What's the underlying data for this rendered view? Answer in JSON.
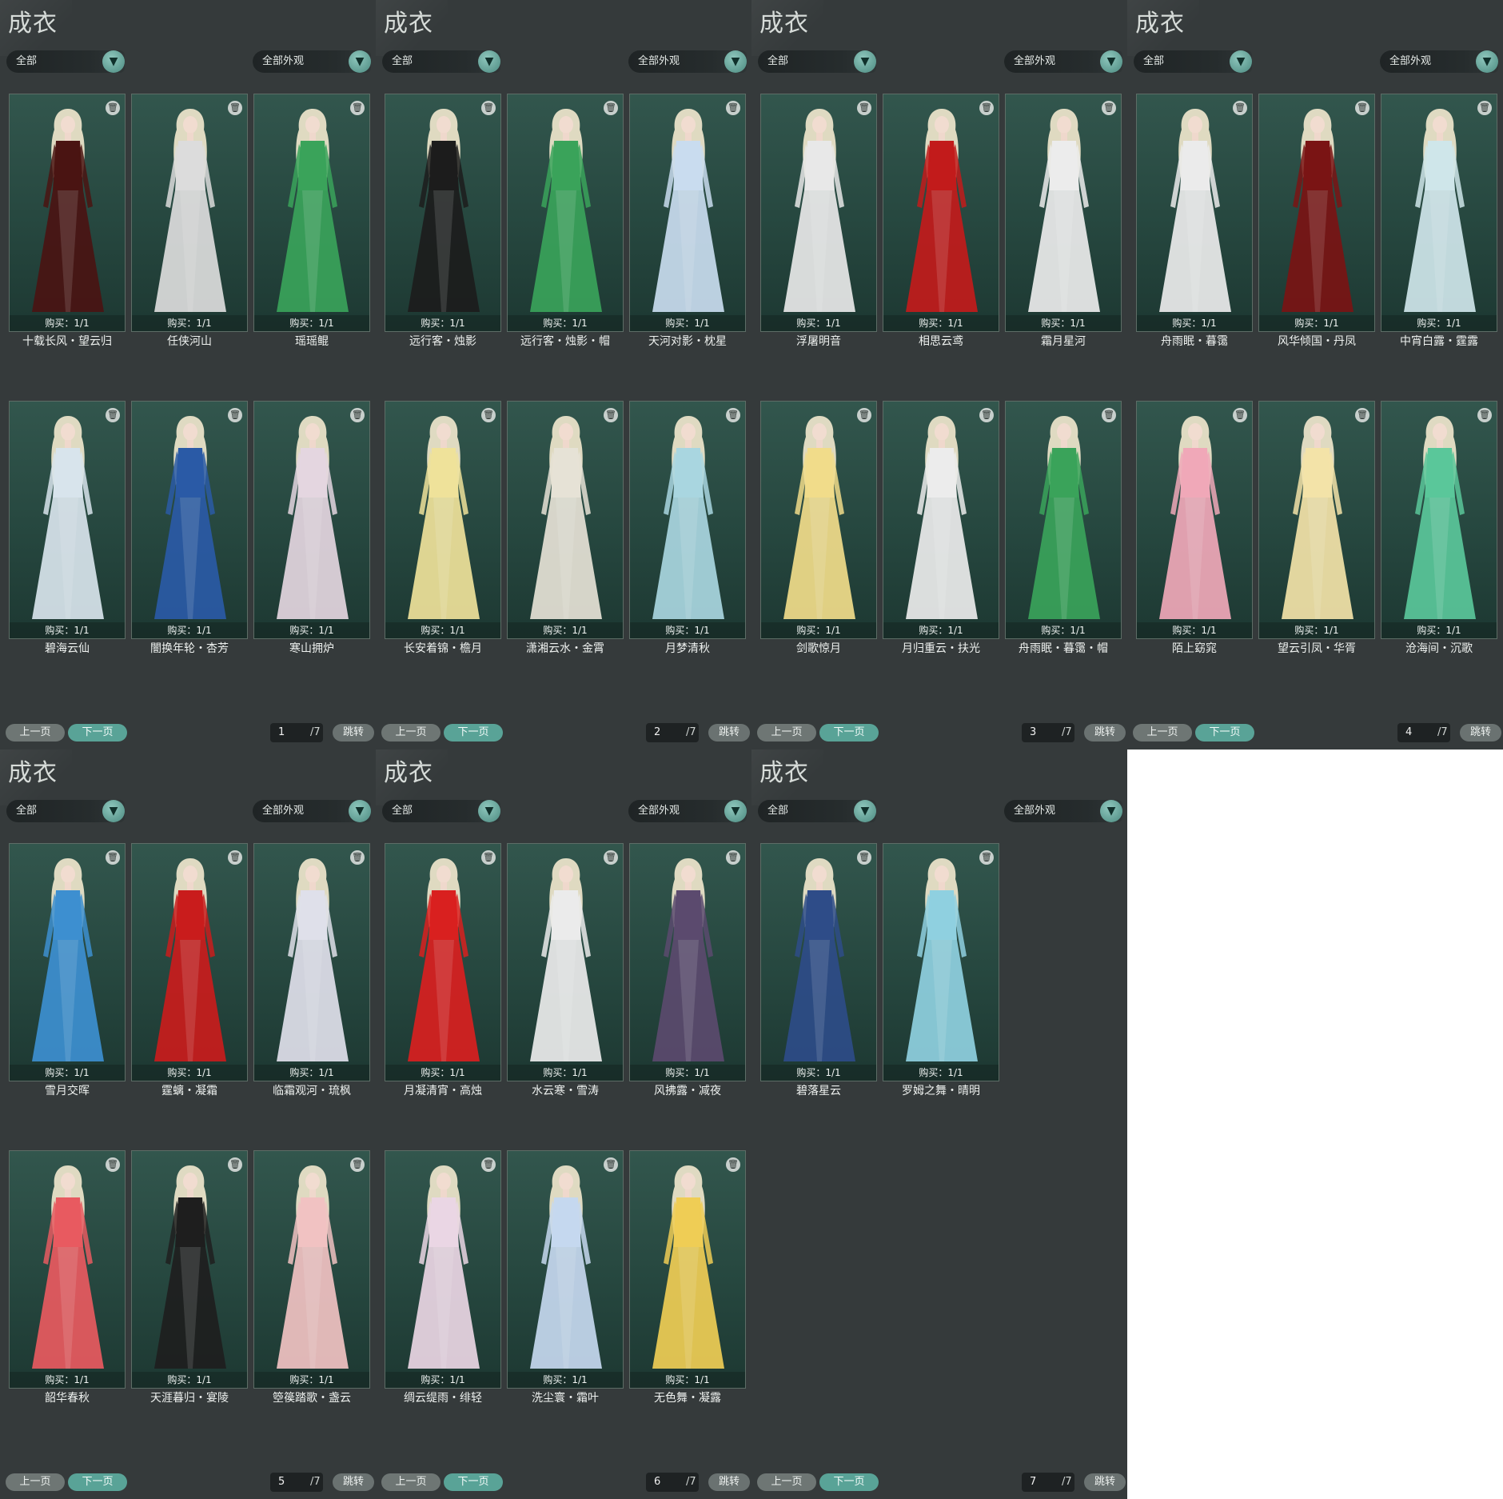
{
  "colors": {
    "panel_bg": "#353a3b",
    "card_bg": "#2a4b43",
    "accent": "#59a397",
    "page_bg": "#ffffff"
  },
  "panels": [
    {
      "title": "成衣",
      "filter_left": "全部",
      "filter_right": "全部外观",
      "prev_label": "上一页",
      "next_label": "下一页",
      "page": "1",
      "total": "/7",
      "jump_label": "跳转",
      "items": [
        {
          "name": "十载长风・望云归",
          "buy": "购买：1/1",
          "color": "#4a1412"
        },
        {
          "name": "任侠河山",
          "buy": "购买：1/1",
          "color": "#dcdcdc"
        },
        {
          "name": "瑶瑶鲲",
          "buy": "购买：1/1",
          "color": "#3aa35a"
        },
        {
          "name": "碧海云仙",
          "buy": "购买：1/1",
          "color": "#d8e4ec"
        },
        {
          "name": "闇换年轮・杏芳",
          "buy": "购买：1/1",
          "color": "#2a5aa6"
        },
        {
          "name": "寒山拥炉",
          "buy": "购买：1/1",
          "color": "#e4d6e0"
        }
      ]
    },
    {
      "title": "成衣",
      "filter_left": "全部",
      "filter_right": "全部外观",
      "prev_label": "上一页",
      "next_label": "下一页",
      "page": "2",
      "total": "/7",
      "jump_label": "跳转",
      "items": [
        {
          "name": "远行客・烛影",
          "buy": "购买：1/1",
          "color": "#1c1c1c"
        },
        {
          "name": "远行客・烛影・帽",
          "buy": "购买：1/1",
          "color": "#3aa35a"
        },
        {
          "name": "天河对影・枕星",
          "buy": "购买：1/1",
          "color": "#c9dcef"
        },
        {
          "name": "长安着锦・檐月",
          "buy": "购买：1/1",
          "color": "#efe29a"
        },
        {
          "name": "潇湘云水・金霄",
          "buy": "购买：1/1",
          "color": "#e6e2d6"
        },
        {
          "name": "月梦清秋",
          "buy": "购买：1/1",
          "color": "#a9d6e0"
        }
      ]
    },
    {
      "title": "成衣",
      "filter_left": "全部",
      "filter_right": "全部外观",
      "prev_label": "上一页",
      "next_label": "下一页",
      "page": "3",
      "total": "/7",
      "jump_label": "跳转",
      "items": [
        {
          "name": "浮屠明音",
          "buy": "购买：1/1",
          "color": "#e8e8e8"
        },
        {
          "name": "相思云鸢",
          "buy": "购买：1/1",
          "color": "#c21b1b"
        },
        {
          "name": "霜月星河",
          "buy": "购买：1/1",
          "color": "#ececec"
        },
        {
          "name": "剑歌惊月",
          "buy": "购买：1/1",
          "color": "#f1dc8a"
        },
        {
          "name": "月归重云・扶光",
          "buy": "购买：1/1",
          "color": "#ececec"
        },
        {
          "name": "舟雨眠・暮霭・帽",
          "buy": "购买：1/1",
          "color": "#3aa35a"
        }
      ]
    },
    {
      "title": "成衣",
      "filter_left": "全部",
      "filter_right": "全部外观",
      "prev_label": "上一页",
      "next_label": "下一页",
      "page": "4",
      "total": "/7",
      "jump_label": "跳转",
      "items": [
        {
          "name": "舟雨眠・暮霭",
          "buy": "购买：1/1",
          "color": "#ebebeb"
        },
        {
          "name": "风华倾国・丹凤",
          "buy": "购买：1/1",
          "color": "#7a1414"
        },
        {
          "name": "中宵白露・霆露",
          "buy": "购买：1/1",
          "color": "#cfe6ea"
        },
        {
          "name": "陌上窈窕",
          "buy": "购买：1/1",
          "color": "#f0a8b8"
        },
        {
          "name": "望云引凤・华胥",
          "buy": "购买：1/1",
          "color": "#f3e3a8"
        },
        {
          "name": "沧海间・沉歌",
          "buy": "购买：1/1",
          "color": "#5ac79a"
        }
      ]
    },
    {
      "title": "成衣",
      "filter_left": "全部",
      "filter_right": "全部外观",
      "prev_label": "上一页",
      "next_label": "下一页",
      "page": "5",
      "total": "/7",
      "jump_label": "跳转",
      "items": [
        {
          "name": "雪月交晖",
          "buy": "购买：1/1",
          "color": "#3d8fd0"
        },
        {
          "name": "霆螭・凝霜",
          "buy": "购买：1/1",
          "color": "#c91c1c"
        },
        {
          "name": "临霜观河・琉枫",
          "buy": "购买：1/1",
          "color": "#dfe0ea"
        },
        {
          "name": "韶华春秋",
          "buy": "购买：1/1",
          "color": "#e85a60"
        },
        {
          "name": "天涯暮归・宴陵",
          "buy": "购买：1/1",
          "color": "#1e1e1e"
        },
        {
          "name": "箜篌踏歌・盏云",
          "buy": "购买：1/1",
          "color": "#f1c2c2"
        }
      ]
    },
    {
      "title": "成衣",
      "filter_left": "全部",
      "filter_right": "全部外观",
      "prev_label": "上一页",
      "next_label": "下一页",
      "page": "6",
      "total": "/7",
      "jump_label": "跳转",
      "items": [
        {
          "name": "月凝清宵・高烛",
          "buy": "购买：1/1",
          "color": "#d9201f"
        },
        {
          "name": "水云寒・雪涛",
          "buy": "购买：1/1",
          "color": "#ebebeb"
        },
        {
          "name": "风拂露・减夜",
          "buy": "购买：1/1",
          "color": "#5b4a6e"
        },
        {
          "name": "绸云缇雨・绯轻",
          "buy": "购买：1/1",
          "color": "#ead6e4"
        },
        {
          "name": "洗尘寰・霜叶",
          "buy": "购买：1/1",
          "color": "#c5d8ef"
        },
        {
          "name": "无色舞・凝露",
          "buy": "购买：1/1",
          "color": "#efcd55"
        }
      ]
    },
    {
      "title": "成衣",
      "filter_left": "全部",
      "filter_right": "全部外观",
      "prev_label": "上一页",
      "next_label": "下一页",
      "page": "7",
      "total": "/7",
      "jump_label": "跳转",
      "items": [
        {
          "name": "碧落星云",
          "buy": "购买：1/1",
          "color": "#2e4c88"
        },
        {
          "name": "罗姆之舞・晴明",
          "buy": "购买：1/1",
          "color": "#8fd0e0"
        }
      ]
    }
  ]
}
